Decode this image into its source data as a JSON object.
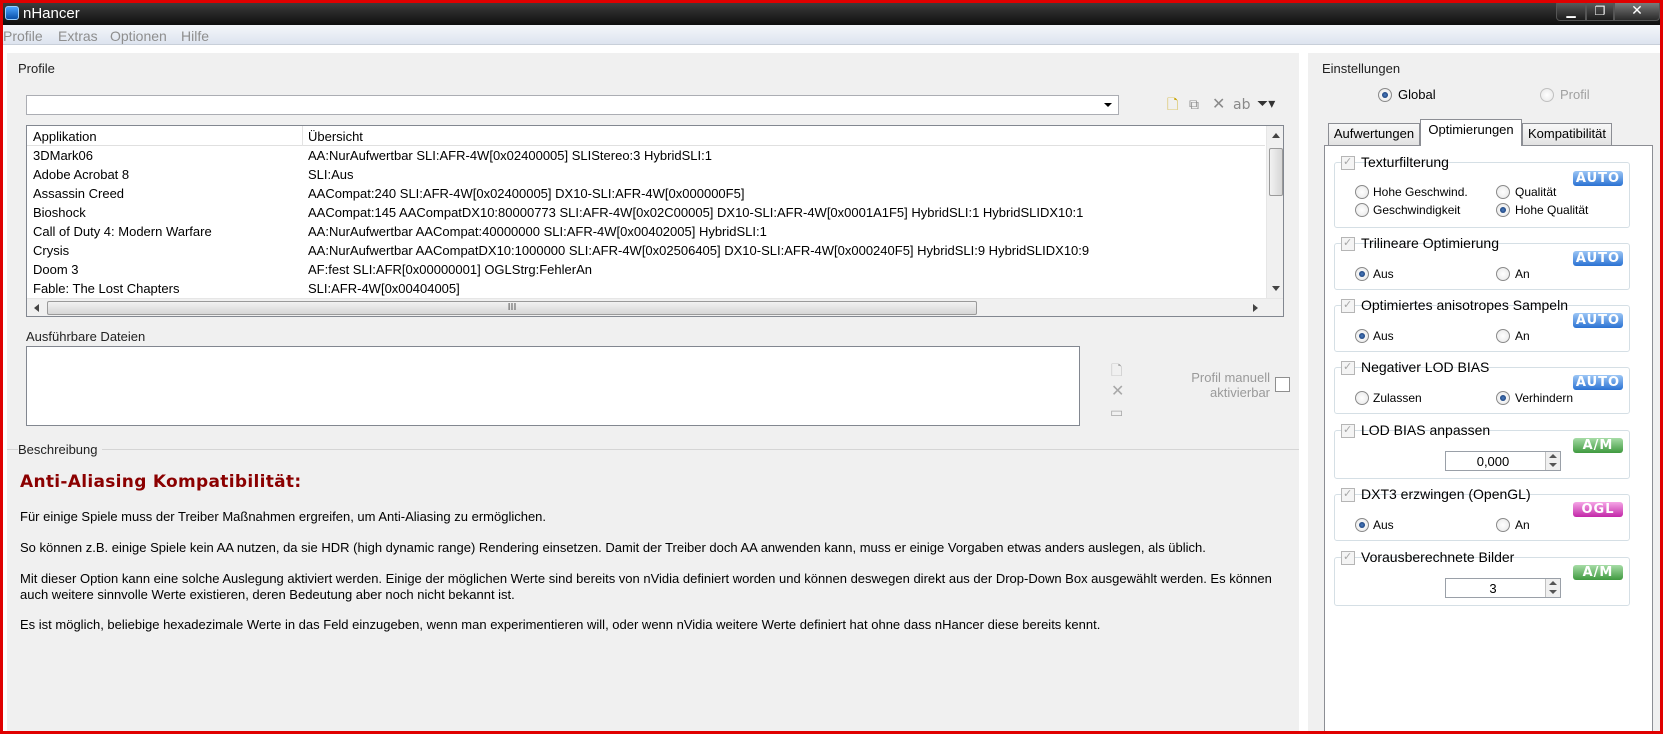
{
  "window": {
    "title": "nHancer"
  },
  "menu": [
    "Profile",
    "Extras",
    "Optionen",
    "Hilfe"
  ],
  "profile_section": {
    "label": "Profile",
    "combo_value": "",
    "columns": [
      "Applikation",
      "Übersicht"
    ],
    "rows": [
      {
        "app": "3DMark06",
        "overview": "AA:NurAufwertbar SLI:AFR-4W[0x02400005] SLIStereo:3 HybridSLI:1"
      },
      {
        "app": "Adobe Acrobat 8",
        "overview": "SLI:Aus"
      },
      {
        "app": "Assassin Creed",
        "overview": "AACompat:240 SLI:AFR-4W[0x02400005] DX10-SLI:AFR-4W[0x000000F5]"
      },
      {
        "app": "Bioshock",
        "overview": "AACompat:145 AACompatDX10:80000773 SLI:AFR-4W[0x02C00005] DX10-SLI:AFR-4W[0x0001A1F5] HybridSLI:1 HybridSLIDX10:1"
      },
      {
        "app": "Call of Duty 4: Modern Warfare",
        "overview": "AA:NurAufwertbar AACompat:40000000 SLI:AFR-4W[0x00402005] HybridSLI:1"
      },
      {
        "app": "Crysis",
        "overview": "AA:NurAufwertbar AACompatDX10:1000000 SLI:AFR-4W[0x02506405] DX10-SLI:AFR-4W[0x000240F5] HybridSLI:9 HybridSLIDX10:9"
      },
      {
        "app": "Doom 3",
        "overview": "AF:fest SLI:AFR[0x00000001] OGLStrg:FehlerAn"
      },
      {
        "app": "Fable: The Lost Chapters",
        "overview": "SLI:AFR-4W[0x00404005]"
      }
    ],
    "scroll_grip": "III"
  },
  "executables": {
    "label": "Ausführbare Dateien",
    "manual_label_1": "Profil manuell",
    "manual_label_2": "aktivierbar"
  },
  "description": {
    "label": "Beschreibung",
    "heading": "Anti-Aliasing Kompatibilität:",
    "paragraphs": [
      "Für einige Spiele muss der Treiber Maßnahmen ergreifen, um Anti-Aliasing zu ermöglichen.",
      "So können z.B. einige Spiele kein AA nutzen, da sie HDR (high dynamic range) Rendering einsetzen. Damit der Treiber doch AA anwenden kann, muss er einige Vorgaben etwas anders auslegen, als üblich.",
      "Mit dieser Option kann eine solche Auslegung aktiviert werden. Einige der möglichen Werte sind bereits von nVidia definiert worden und können deswegen direkt aus der Drop-Down Box ausgewählt werden. Es können auch weitere sinnvolle Werte existieren, deren Bedeutung aber noch nicht bekannt ist.",
      "Es ist möglich, beliebige hexadezimale Werte in das Feld einzugeben, wenn man experimentieren will, oder wenn nVidia weitere Werte definiert hat ohne dass nHancer diese bereits kennt."
    ]
  },
  "settings": {
    "label": "Einstellungen",
    "scope_global": "Global",
    "scope_profile": "Profil",
    "tabs": [
      "Aufwertungen",
      "Optimierungen",
      "Kompatibilität"
    ],
    "active_tab": "Optimierungen",
    "groups": {
      "texture": {
        "title": "Texturfilterung",
        "badge": "AUTO",
        "opt1": "Hohe Geschwind.",
        "opt2": "Qualität",
        "opt3": "Geschwindigkeit",
        "opt4": "Hohe Qualität",
        "selected": "Hohe Qualität"
      },
      "trilinear": {
        "title": "Trilineare Optimierung",
        "badge": "AUTO",
        "opt1": "Aus",
        "opt2": "An",
        "selected": "Aus"
      },
      "aniso": {
        "title": "Optimiertes anisotropes Sampeln",
        "badge": "AUTO",
        "opt1": "Aus",
        "opt2": "An",
        "selected": "Aus"
      },
      "neglod": {
        "title": "Negativer LOD BIAS",
        "badge": "AUTO",
        "opt1": "Zulassen",
        "opt2": "Verhindern",
        "selected": "Verhindern"
      },
      "lodbias": {
        "title": "LOD BIAS anpassen",
        "badge": "A/M",
        "value": "0,000"
      },
      "dxt3": {
        "title": "DXT3 erzwingen (OpenGL)",
        "badge": "OGL",
        "opt1": "Aus",
        "opt2": "An",
        "selected": "Aus"
      },
      "prerender": {
        "title": "Vorausberechnete Bilder",
        "badge": "A/M",
        "value": "3"
      }
    }
  }
}
